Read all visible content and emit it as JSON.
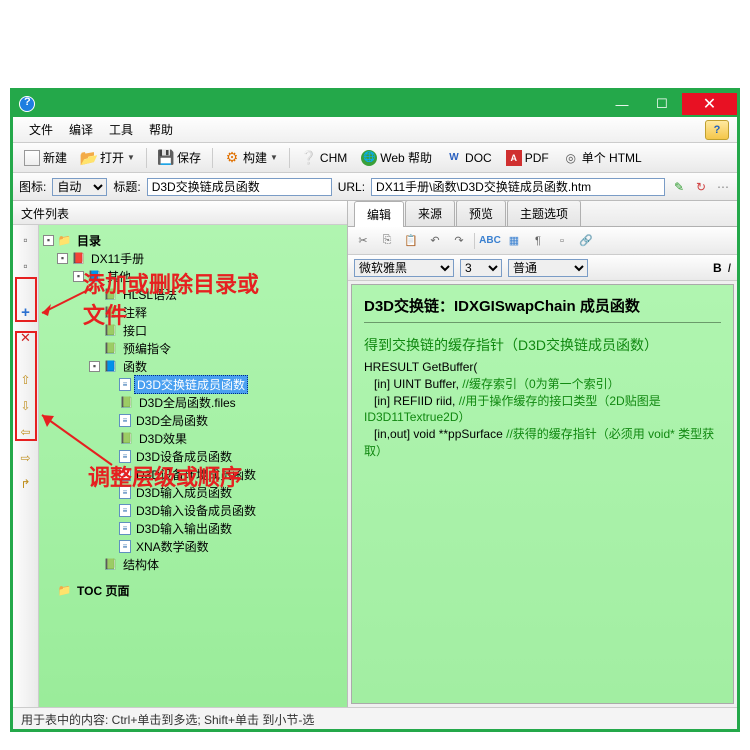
{
  "menu": {
    "file": "文件",
    "translate": "编译",
    "tools": "工具",
    "help": "帮助"
  },
  "toolbar": {
    "new": "新建",
    "open": "打开",
    "save": "保存",
    "build": "构建",
    "chm": "CHM",
    "webhelp": "Web 帮助",
    "doc": "DOC",
    "pdf": "PDF",
    "singlehtml": "单个 HTML"
  },
  "toolbar2": {
    "iconLabel": "图标:",
    "iconValue": "自动",
    "titleLabel": "标题:",
    "titleValue": "D3D交换链成员函数",
    "urlLabel": "URL:",
    "urlValue": "DX11手册\\函数\\D3D交换链成员函数.htm"
  },
  "left": {
    "header": "文件列表",
    "tree": {
      "root": "目录",
      "dx11": "DX11手册",
      "other": "其他",
      "hlsl": "HLSL语法",
      "zhu": "注释",
      "jiekou": "接口",
      "yichu": "预编指令",
      "funcs": "函数",
      "f1": "D3D交换链成员函数",
      "f2": "D3D全局函数.files",
      "f3": "D3D全局函数",
      "f4": "D3D效果",
      "f5": "D3D设备成员函数",
      "f6": "D3D设备环境成员函数",
      "f7": "D3D输入成员函数",
      "f8": "D3D输入设备成员函数",
      "f9": "D3D输入输出函数",
      "f10": "XNA数学函数",
      "struct": "结构体",
      "toc": "TOC 页面"
    }
  },
  "tabs": {
    "edit": "编辑",
    "source": "来源",
    "preview": "预览",
    "topicopt": "主题选项"
  },
  "fontbar": {
    "font": "微软雅黑",
    "size": "3",
    "style": "普通"
  },
  "editor": {
    "heading": "D3D交换链：IDXGISwapChain 成员函数",
    "sec1": "得到交换链的缓存指针（D3D交换链成员函数）",
    "code": "HRESULT GetBuffer(\n   [in] UINT Buffer, //缓存索引（0为第一个索引）\n   [in] REFIID riid, //用于操作缓存的接口类型（2D贴图是ID3D11Textrue2D）\n   [in,out] void **ppSurface //获得的缓存指针（必须用 void* 类型获取）"
  },
  "status": "用于表中的内容: Ctrl+单击到多选; Shift+单击 到小节-选",
  "annotations": {
    "a1": "添加或删除目录或文件",
    "a2": "调整层级或顺序"
  }
}
